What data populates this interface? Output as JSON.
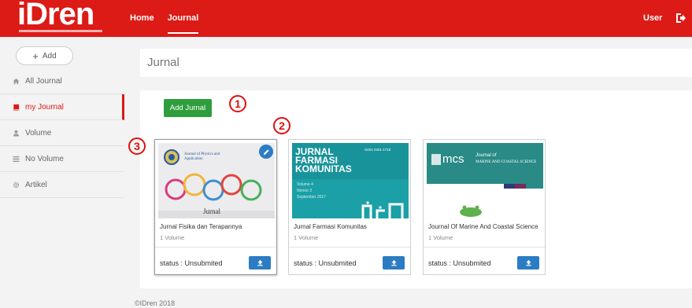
{
  "header": {
    "logo": "iDren",
    "nav": [
      {
        "label": "Home"
      },
      {
        "label": "Journal"
      }
    ],
    "user_label": "User",
    "logout_icon": "logout-icon",
    "brand_color": "#dc1a16"
  },
  "sidebar": {
    "add_label": "Add",
    "items": [
      {
        "label": "All Journal",
        "icon": "home-icon"
      },
      {
        "label": "my Journal",
        "icon": "book-icon"
      },
      {
        "label": "Volume",
        "icon": "user-icon"
      },
      {
        "label": "No Volume",
        "icon": "list-icon"
      },
      {
        "label": "Artikel",
        "icon": "gear-icon"
      }
    ]
  },
  "main": {
    "title": "Jurnal",
    "add_jurnal_label": "Add Jurnal",
    "markers": [
      "1",
      "2",
      "3"
    ],
    "cards": [
      {
        "title": "Jurnal Fisika dan Terapannya",
        "volume": "1 Volume",
        "status": "status : Unsubmited",
        "cover_heading": "Journal of Physics and Application",
        "cover_word": "Jurnal"
      },
      {
        "title": "Jurnal Farmasi Komunitas",
        "volume": "1 Volume",
        "status": "status : Unsubmited",
        "cover_line1": "JURNAL",
        "cover_line2": "FARMASI",
        "cover_line3": "KOMUNITAS",
        "cover_meta": "ISSN 2301-1718",
        "cover_vol": "Volume 4",
        "cover_num": "Nomor 2",
        "cover_date": "September 2017"
      },
      {
        "title": "Journal Of Marine And Coastal Science",
        "volume": "1 Volume",
        "status": "status : Unsubmited",
        "cover_mcs": "mcs",
        "cover_journal": "Journal of",
        "cover_name": "MARINE AND COASTAL SCIENCE"
      }
    ]
  },
  "footer": {
    "copyright": "©IDren 2018"
  }
}
